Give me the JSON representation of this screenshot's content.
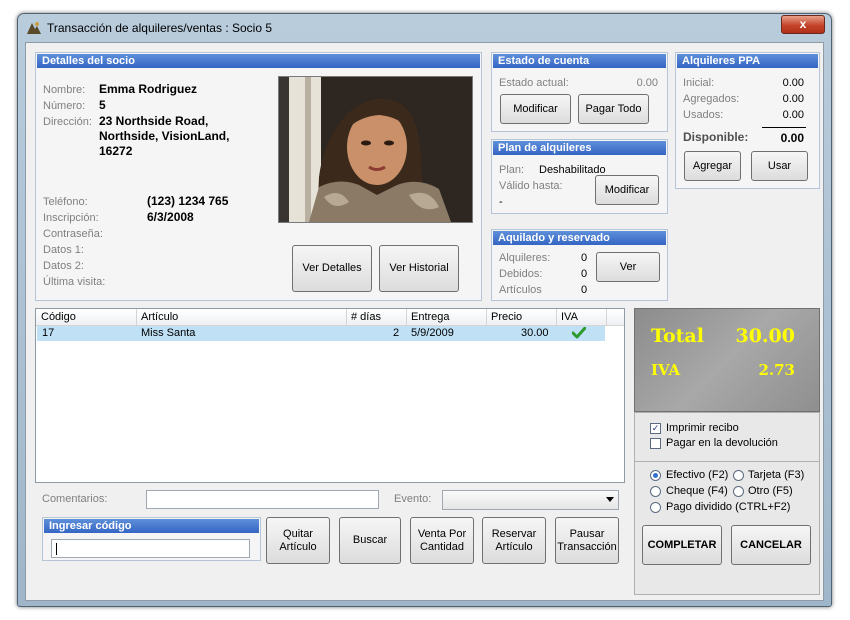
{
  "window": {
    "title": "Transacción de alquileres/ventas : Socio 5",
    "close": "x"
  },
  "socio": {
    "header": "Detalles del socio",
    "nombre_lbl": "Nombre:",
    "nombre": "Emma Rodriguez",
    "numero_lbl": "Número:",
    "numero": "5",
    "direccion_lbl": "Dirección:",
    "direccion_1": "23 Northside Road,",
    "direccion_2": "Northside, VisionLand,",
    "direccion_3": "16272",
    "telefono_lbl": "Teléfono:",
    "telefono": "(123) 1234 765",
    "inscripcion_lbl": "Inscripción:",
    "inscripcion": "6/3/2008",
    "contrasena_lbl": "Contraseña:",
    "datos1_lbl": "Datos 1:",
    "datos2_lbl": "Datos 2:",
    "ultima_lbl": "Última visita:",
    "ver_detalles": "Ver Detalles",
    "ver_historial": "Ver Historial"
  },
  "estado": {
    "header": "Estado de cuenta",
    "actual_lbl": "Estado actual:",
    "actual": "0.00",
    "modificar": "Modificar",
    "pagar_todo": "Pagar Todo"
  },
  "plan": {
    "header": "Plan de alquileres",
    "plan_lbl": "Plan:",
    "plan": "Deshabilitado",
    "valido_lbl": "Válido hasta:",
    "valido": "-",
    "modificar": "Modificar"
  },
  "aquilado": {
    "header": "Aquilado y reservado",
    "alquileres_lbl": "Alquileres:",
    "alquileres": "0",
    "debidos_lbl": "Debidos:",
    "debidos": "0",
    "articulos_lbl": "Artículos",
    "articulos": "0",
    "ver": "Ver"
  },
  "ppa": {
    "header": "Alquileres PPA",
    "inicial_lbl": "Inicial:",
    "inicial": "0.00",
    "agregados_lbl": "Agregados:",
    "agregados": "0.00",
    "usados_lbl": "Usados:",
    "usados": "0.00",
    "disponible_lbl": "Disponible:",
    "disponible": "0.00",
    "agregar": "Agregar",
    "usar": "Usar"
  },
  "table": {
    "headers": [
      "Código",
      "Artículo",
      "# días",
      "Entrega",
      "Precio",
      "IVA"
    ],
    "rows": [
      {
        "codigo": "17",
        "articulo": "Miss Santa",
        "dias": "2",
        "entrega": "5/9/2009",
        "precio": "30.00",
        "iva": "check-icon"
      }
    ]
  },
  "totals": {
    "total_lbl": "Total",
    "total": "30.00",
    "iva_lbl": "IVA",
    "iva": "2.73"
  },
  "opciones": {
    "imprimir": "Imprimir recibo",
    "pagar_devolucion": "Pagar en la devolución"
  },
  "pago": {
    "efectivo": "Efectivo (F2)",
    "tarjeta": "Tarjeta (F3)",
    "cheque": "Cheque (F4)",
    "otro": "Otro (F5)",
    "dividido": "Pago dividido (CTRL+F2)",
    "completar": "COMPLETAR",
    "cancelar": "CANCELAR"
  },
  "bottom": {
    "comentarios_lbl": "Comentarios:",
    "evento_lbl": "Evento:",
    "ingresar_header": "Ingresar código",
    "quitar_1": "Quitar",
    "quitar_2": "Artículo",
    "buscar": "Buscar",
    "venta_1": "Venta Por",
    "venta_2": "Cantidad",
    "reservar_1": "Reservar",
    "reservar_2": "Artículo",
    "pausar_1": "Pausar",
    "pausar_2": "Transacción"
  }
}
